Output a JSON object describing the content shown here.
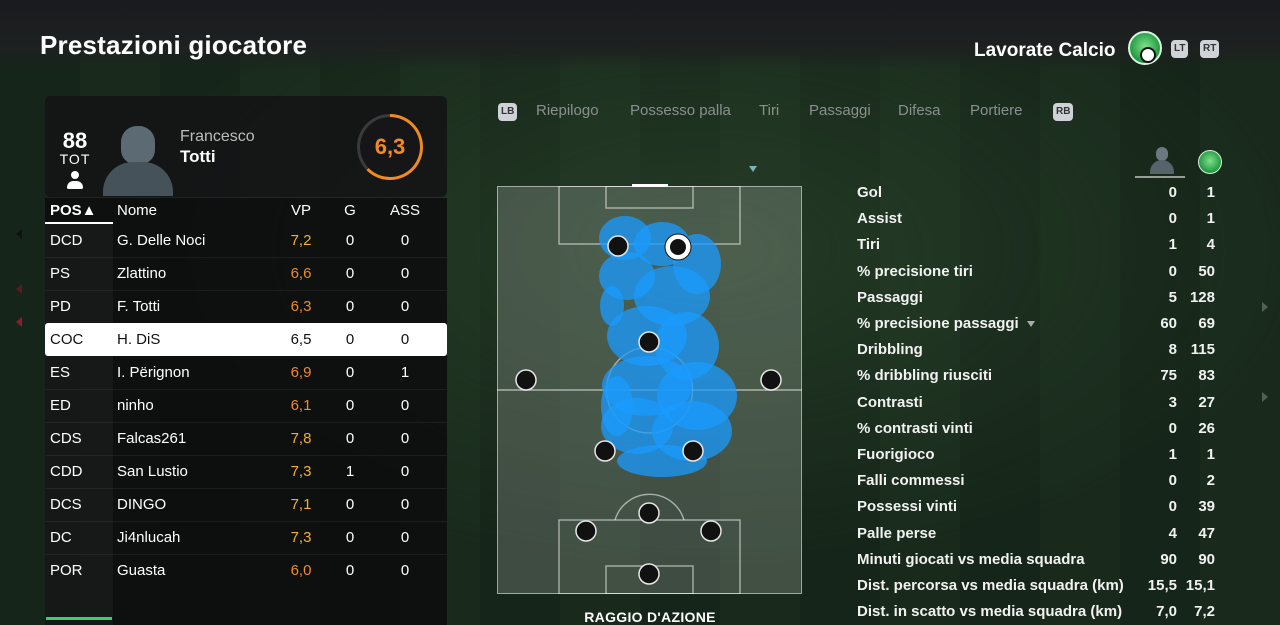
{
  "header": {
    "title": "Prestazioni giocatore",
    "club_name": "Lavorate Calcio",
    "lt": "LT",
    "rt": "RT"
  },
  "player": {
    "overall": "88",
    "position": "TOT",
    "first_name": "Francesco",
    "last_name": "Totti",
    "rating": "6,3"
  },
  "table": {
    "headers": {
      "pos": "POS▲",
      "name": "Nome",
      "vp": "VP",
      "g": "G",
      "ass": "ASS"
    },
    "rows": [
      {
        "pos": "DCD",
        "name": "G. Delle Noci",
        "vp": "7,2",
        "g": "0",
        "ass": "0",
        "vp_color": "gold"
      },
      {
        "pos": "PS",
        "name": "Zlattino",
        "vp": "6,6",
        "g": "0",
        "ass": "0",
        "vp_color": "orange"
      },
      {
        "pos": "PD",
        "name": "F. Totti",
        "vp": "6,3",
        "g": "0",
        "ass": "0",
        "vp_color": "orange"
      },
      {
        "pos": "COC",
        "name": "H. DiS",
        "vp": "6,5",
        "g": "0",
        "ass": "0",
        "vp_color": "selected"
      },
      {
        "pos": "ES",
        "name": "I. Përignon",
        "vp": "6,9",
        "g": "0",
        "ass": "1",
        "vp_color": "orange"
      },
      {
        "pos": "ED",
        "name": "ninho",
        "vp": "6,1",
        "g": "0",
        "ass": "0",
        "vp_color": "orange"
      },
      {
        "pos": "CDS",
        "name": "Falcas261",
        "vp": "7,8",
        "g": "0",
        "ass": "0",
        "vp_color": "gold"
      },
      {
        "pos": "CDD",
        "name": "San Lustio",
        "vp": "7,3",
        "g": "1",
        "ass": "0",
        "vp_color": "gold"
      },
      {
        "pos": "DCS",
        "name": "DINGO",
        "vp": "7,1",
        "g": "0",
        "ass": "0",
        "vp_color": "gold"
      },
      {
        "pos": "DC",
        "name": "Ji4nlucah",
        "vp": "7,3",
        "g": "0",
        "ass": "0",
        "vp_color": "gold"
      },
      {
        "pos": "POR",
        "name": "Guasta",
        "vp": "6,0",
        "g": "0",
        "ass": "0",
        "vp_color": "orange"
      }
    ],
    "selected_index": 3
  },
  "tabs": {
    "lb": "LB",
    "rb": "RB",
    "items": [
      "Riepilogo",
      "Possesso palla",
      "Tiri",
      "Passaggi",
      "Difesa",
      "Portiere"
    ],
    "active": "Riepilogo"
  },
  "pitch": {
    "title": "RAGGIO D'AZIONE",
    "heat_color": "#1a9bff"
  },
  "stats": {
    "rows": [
      {
        "label": "Gol",
        "player": "0",
        "team": "1"
      },
      {
        "label": "Assist",
        "player": "0",
        "team": "1"
      },
      {
        "label": "Tiri",
        "player": "1",
        "team": "4"
      },
      {
        "label": "% precisione tiri",
        "player": "0",
        "team": "50"
      },
      {
        "label": "Passaggi",
        "player": "5",
        "team": "128"
      },
      {
        "label": "% precisione passaggi",
        "player": "60",
        "team": "69"
      },
      {
        "label": "Dribbling",
        "player": "8",
        "team": "115"
      },
      {
        "label": "% dribbling riusciti",
        "player": "75",
        "team": "83"
      },
      {
        "label": "Contrasti",
        "player": "3",
        "team": "27"
      },
      {
        "label": "% contrasti vinti",
        "player": "0",
        "team": "26"
      },
      {
        "label": "Fuorigioco",
        "player": "1",
        "team": "1"
      },
      {
        "label": "Falli commessi",
        "player": "0",
        "team": "2"
      },
      {
        "label": "Possessi vinti",
        "player": "0",
        "team": "39"
      },
      {
        "label": "Palle perse",
        "player": "4",
        "team": "47"
      },
      {
        "label": "Minuti giocati vs media squadra",
        "player": "90",
        "team": "90"
      },
      {
        "label": "Dist. percorsa vs media squadra (km)",
        "player": "15,5",
        "team": "15,1"
      },
      {
        "label": "Dist. in scatto vs media squadra (km)",
        "player": "7,0",
        "team": "7,2"
      }
    ]
  },
  "colors": {
    "accent_orange": "#f08a24",
    "accent_gold": "#f4b024",
    "heatmap_blue": "#1a9bff",
    "club_green": "#2ea24b"
  }
}
